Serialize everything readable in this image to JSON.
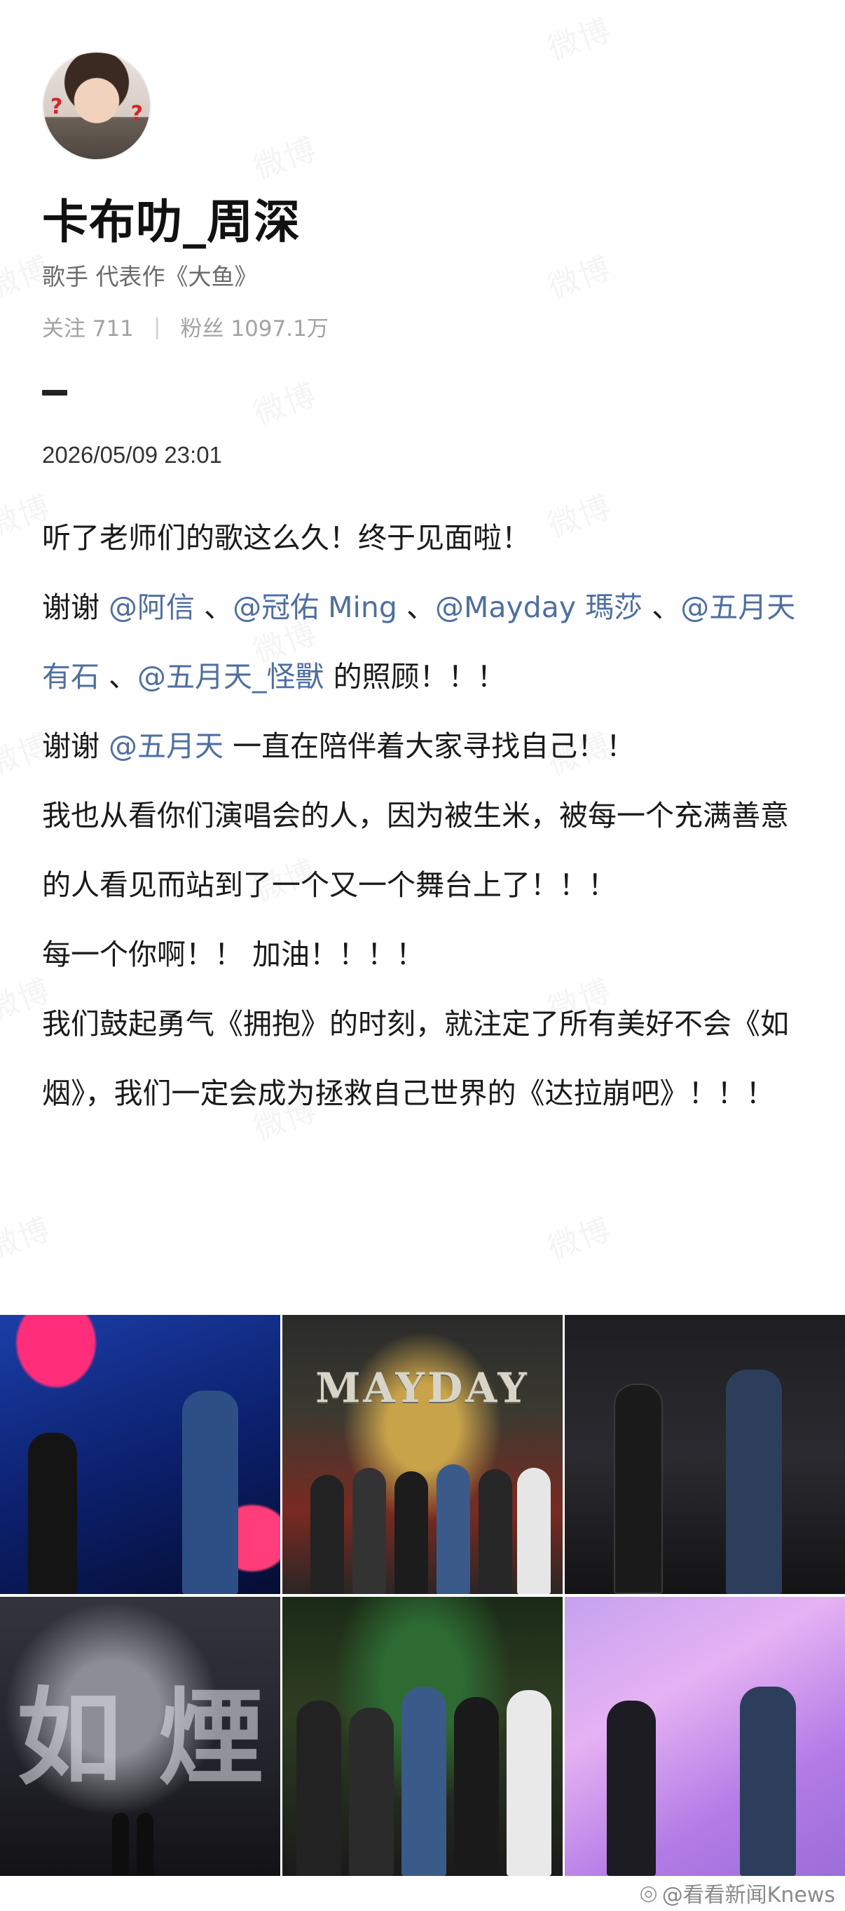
{
  "profile": {
    "name": "卡布叻_周深",
    "bio": "歌手 代表作《大鱼》",
    "follow_label": "关注",
    "follow_count": "711",
    "fans_label": "粉丝",
    "fans_count": "1097.1万"
  },
  "post": {
    "timestamp": "2026/05/09 23:01",
    "line1": "听了老师们的歌这么久！终于见面啦！",
    "line2_prefix": "谢谢 ",
    "mention1": "@阿信",
    "sep1": " 、",
    "mention2": "@冠佑 Ming",
    "sep2": " 、",
    "mention3": "@Mayday 瑪莎",
    "sep3": " 、",
    "mention4": "@五月天有石",
    "sep4": " 、",
    "mention5": "@五月天_怪獸",
    "line2_suffix": " 的照顾！！！",
    "line3_prefix": "谢谢 ",
    "mention6": "@五月天",
    "line3_suffix": "  一直在陪伴着大家寻找自己！！",
    "line4": "我也从看你们演唱会的人，因为被生米，被每一个充满善意的人看见而站到了一个又一个舞台上了！！！",
    "line5": "每一个你啊！！ 加油！！！！",
    "line6": "我们鼓起勇气《拥抱》的时刻，就注定了所有美好不会《如烟》，我们一定会成为拯救自己世界的《达拉崩吧》！！！"
  },
  "photos": {
    "mayday_text": "MAYDAY",
    "ru_text": "如 煙"
  },
  "watermark": "微博",
  "credit": {
    "icon": "weibo-logo-icon",
    "text": "@看看新闻Knews"
  }
}
